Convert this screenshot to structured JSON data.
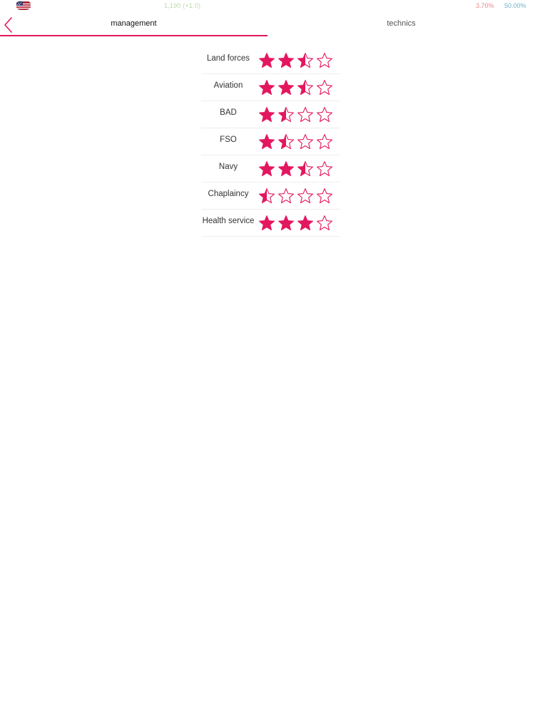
{
  "status_bar": {
    "flag_icon": "us-flag-icon",
    "center_text": "1,190 (+1.0)",
    "right_value_1": "3.70%",
    "right_value_2": "50.00%",
    "colors": {
      "right_value_1": "#e8898c",
      "right_value_2": "#6fb3c9"
    }
  },
  "header": {
    "back_icon": "chevron-left-icon",
    "tabs": [
      {
        "label": "management",
        "active": true
      },
      {
        "label": "technics",
        "active": false
      }
    ]
  },
  "theme": {
    "accent": "#e3175f"
  },
  "ratings": {
    "max_stars": 4,
    "items": [
      {
        "label": "Land forces",
        "stars": 2.5
      },
      {
        "label": "Aviation",
        "stars": 2.5
      },
      {
        "label": "BAD",
        "stars": 1.5
      },
      {
        "label": "FSO",
        "stars": 1.5
      },
      {
        "label": "Navy",
        "stars": 2.5
      },
      {
        "label": "Chaplaincy",
        "stars": 0.5
      },
      {
        "label": "Health service",
        "stars": 3
      }
    ]
  }
}
